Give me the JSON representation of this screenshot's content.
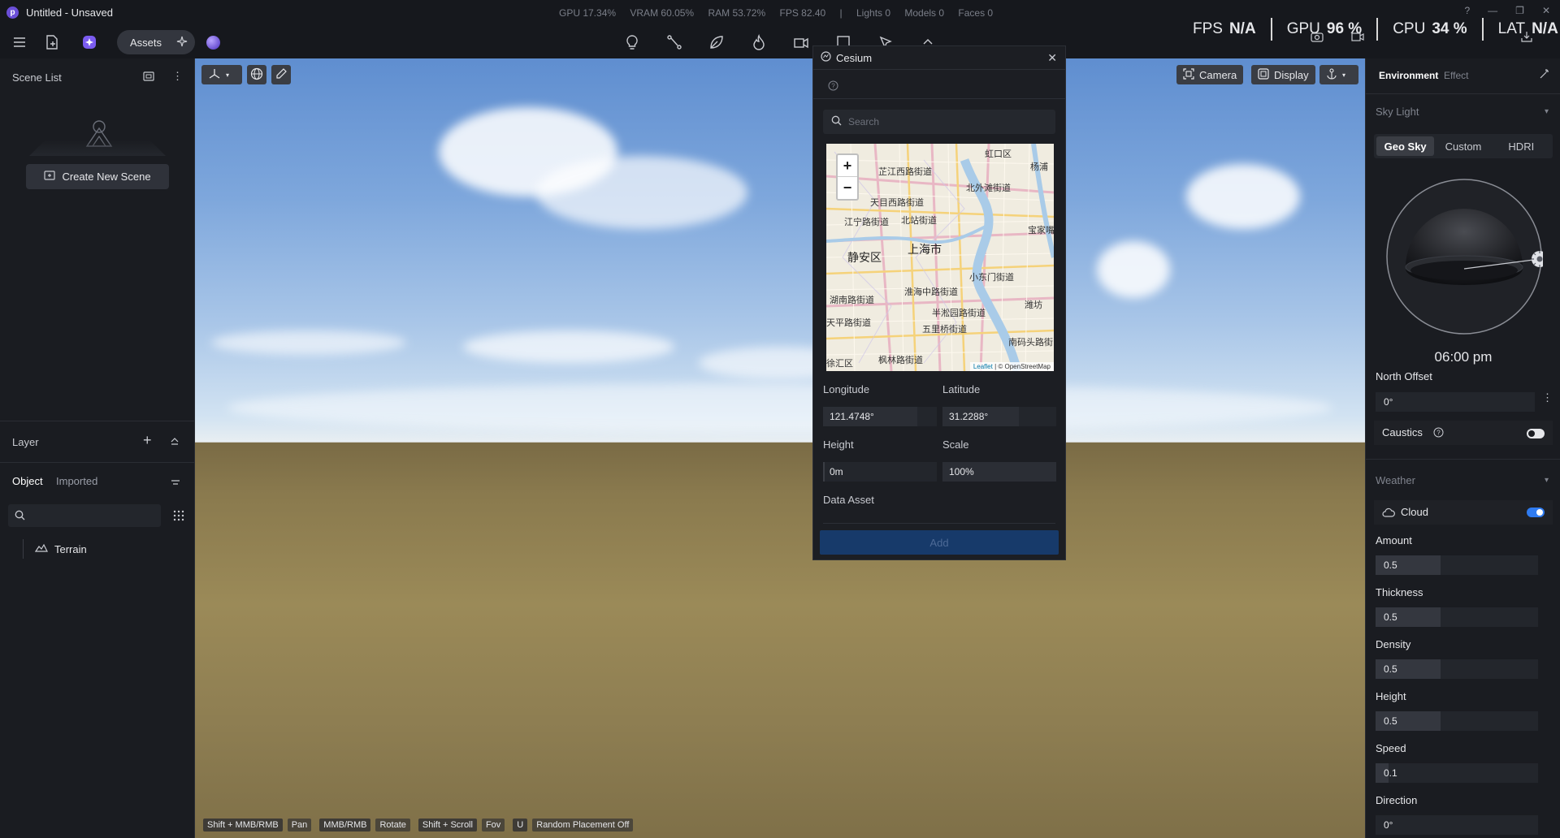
{
  "window": {
    "title": "Untitled - Unsaved",
    "logo_letter": "p"
  },
  "stats": {
    "gpu": "GPU 17.34%",
    "vram": "VRAM 60.05%",
    "ram": "RAM 53.72%",
    "fps": "FPS 82.40",
    "separator": "|",
    "lights": "Lights 0",
    "models": "Models 0",
    "faces": "Faces 0"
  },
  "hud": {
    "fps_label": "FPS",
    "fps_value": "N/A",
    "gpu_label": "GPU",
    "gpu_value": "96 %",
    "cpu_label": "CPU",
    "cpu_value": "34 %",
    "lat_label": "LAT",
    "lat_value": "N/A"
  },
  "toolbar": {
    "assets_label": "Assets",
    "icons": [
      "lightbulb-icon",
      "path-icon",
      "leaf-icon",
      "flame-icon",
      "camera-rig-icon",
      "media-icon",
      "cursor-icon",
      "chevron-up-icon"
    ]
  },
  "left_panel": {
    "scene_list_title": "Scene List",
    "create_scene_label": "Create New Scene",
    "layer_title": "Layer",
    "tabs": [
      "Object",
      "Imported"
    ],
    "tree": [
      {
        "label": "Terrain",
        "icon": "terrain-icon"
      }
    ]
  },
  "viewport": {
    "camera_label": "Camera",
    "display_label": "Display",
    "hints": [
      {
        "key": "Shift + MMB/RMB",
        "action": "Pan"
      },
      {
        "key": "MMB/RMB",
        "action": "Rotate"
      },
      {
        "key": "Shift + Scroll",
        "action": "Fov"
      },
      {
        "key": "U",
        "action": "Random Placement Off"
      }
    ]
  },
  "cesium": {
    "title": "Cesium",
    "search_placeholder": "Search",
    "map": {
      "zoom_in": "+",
      "zoom_out": "−",
      "places": [
        "虹口区",
        "杨浦",
        "芷江西路街道",
        "北外滩街道",
        "天目西路街道",
        "江宁路街道",
        "北站街道",
        "宝家嘴",
        "静安区",
        "上海市",
        "小东门街道",
        "淮海中路街道",
        "湖南路街道",
        "半淞园路街道",
        "天平路街道",
        "五里桥街道",
        "南码头路街",
        "潍坊",
        "枫林路街道",
        "徐汇区"
      ],
      "attribution_leaflet": "Leaflet",
      "attribution_osm": "| © OpenStreetMap"
    },
    "longitude_label": "Longitude",
    "longitude_value": "121.4748°",
    "latitude_label": "Latitude",
    "latitude_value": "31.2288°",
    "height_label": "Height",
    "height_value": "0m",
    "scale_label": "Scale",
    "scale_value": "100%",
    "data_asset_label": "Data Asset",
    "add_label": "Add"
  },
  "right_panel": {
    "tabs": [
      "Environment",
      "Effect"
    ],
    "sky_light_title": "Sky Light",
    "sky_modes": [
      "Geo Sky",
      "Custom",
      "HDRI"
    ],
    "active_sky_mode": "Geo Sky",
    "time": "06:00 pm",
    "north_offset_label": "North Offset",
    "north_offset_value": "0°",
    "caustics_label": "Caustics",
    "caustics_on": false,
    "weather_title": "Weather",
    "cloud_label": "Cloud",
    "cloud_on": true,
    "sliders": [
      {
        "label": "Amount",
        "value": "0.5",
        "fraction": 0.4
      },
      {
        "label": "Thickness",
        "value": "0.5",
        "fraction": 0.4
      },
      {
        "label": "Density",
        "value": "0.5",
        "fraction": 0.4
      },
      {
        "label": "Height",
        "value": "0.5",
        "fraction": 0.4
      },
      {
        "label": "Speed",
        "value": "0.1",
        "fraction": 0.08
      },
      {
        "label": "Direction",
        "value": "0°",
        "fraction": 0.0
      }
    ]
  },
  "colors": {
    "accent": "#2f7bf0",
    "panel_bg": "#1a1c21",
    "add_button_bg": "#173a6a"
  }
}
